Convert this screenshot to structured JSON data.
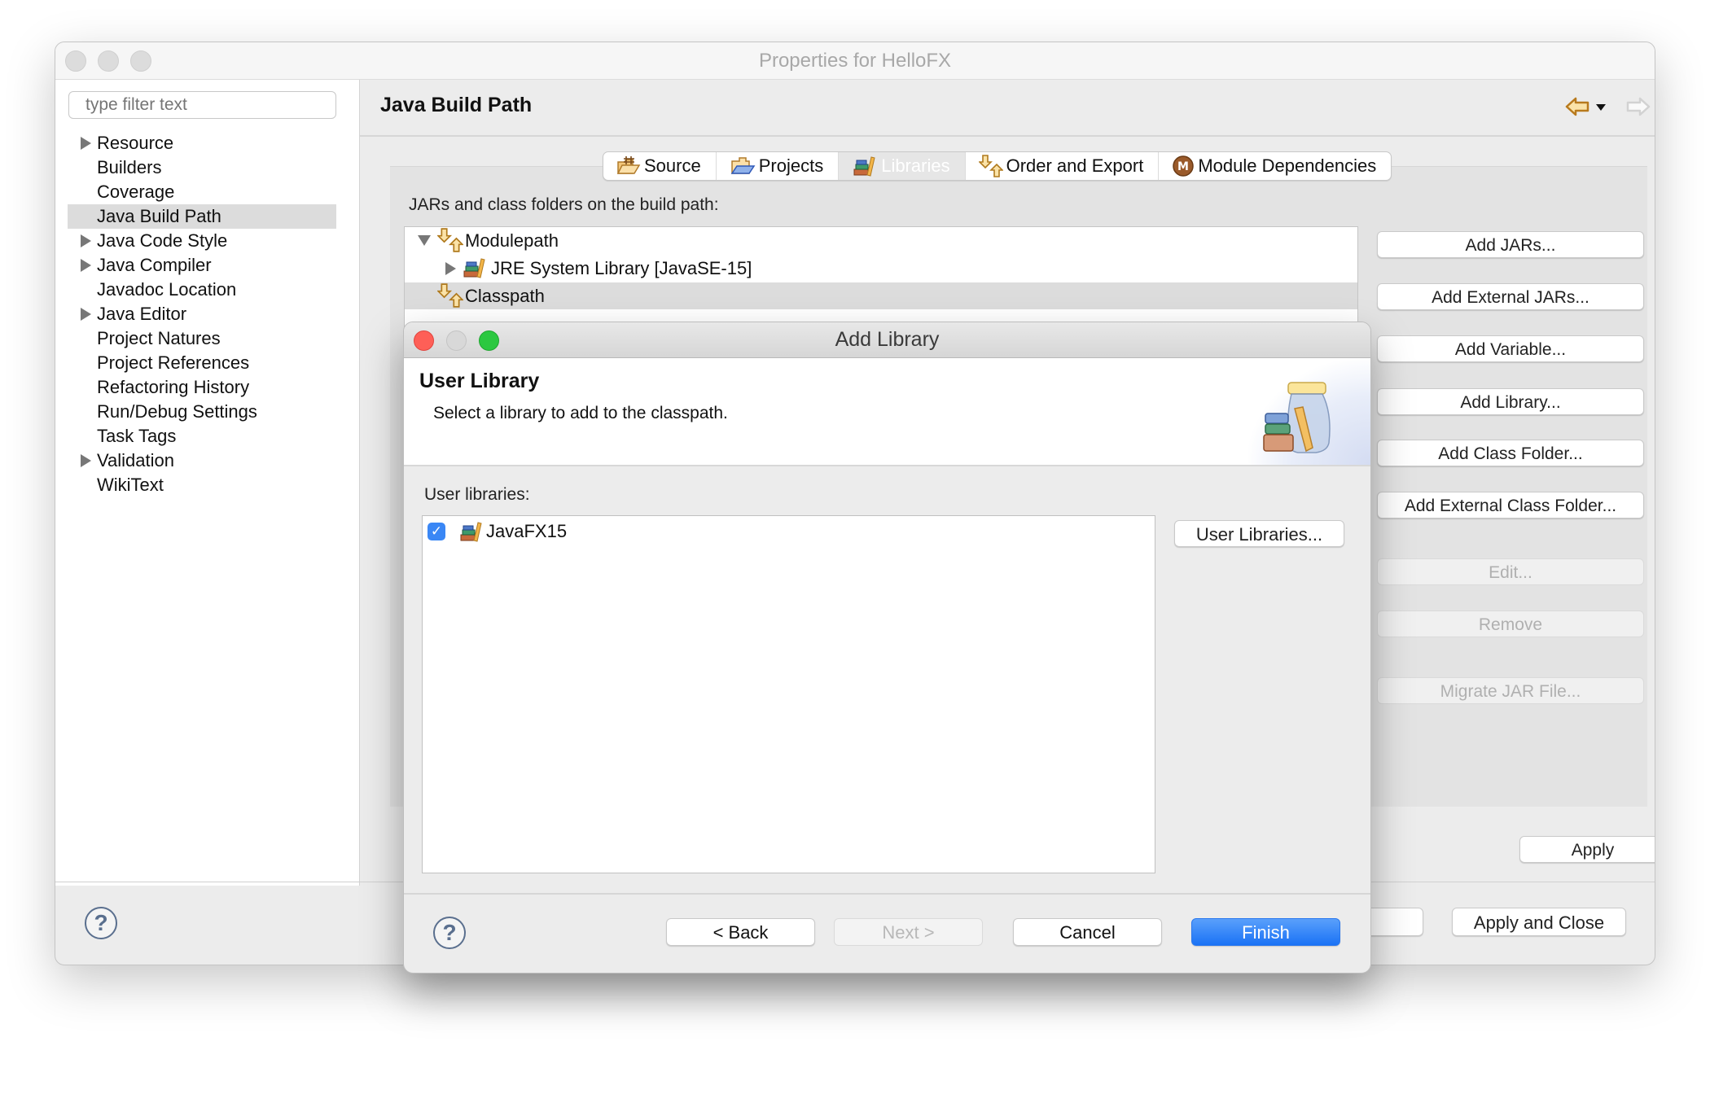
{
  "window": {
    "title": "Properties for HelloFX"
  },
  "sidebar": {
    "filter_placeholder": "type filter text",
    "items": [
      {
        "label": "Resource",
        "expandable": true
      },
      {
        "label": "Builders",
        "expandable": false
      },
      {
        "label": "Coverage",
        "expandable": false
      },
      {
        "label": "Java Build Path",
        "expandable": false,
        "selected": true
      },
      {
        "label": "Java Code Style",
        "expandable": true
      },
      {
        "label": "Java Compiler",
        "expandable": true
      },
      {
        "label": "Javadoc Location",
        "expandable": false
      },
      {
        "label": "Java Editor",
        "expandable": true
      },
      {
        "label": "Project Natures",
        "expandable": false
      },
      {
        "label": "Project References",
        "expandable": false
      },
      {
        "label": "Refactoring History",
        "expandable": false
      },
      {
        "label": "Run/Debug Settings",
        "expandable": false
      },
      {
        "label": "Task Tags",
        "expandable": false
      },
      {
        "label": "Validation",
        "expandable": true
      },
      {
        "label": "WikiText",
        "expandable": false
      }
    ]
  },
  "page": {
    "title": "Java Build Path",
    "nav": {
      "back_icon": "back-arrow-icon",
      "forward_icon": "forward-arrow-icon",
      "menu_icon": "view-menu-icon"
    },
    "tabs": [
      {
        "label": "Source",
        "icon": "source-folder-icon"
      },
      {
        "label": "Projects",
        "icon": "projects-folder-icon"
      },
      {
        "label": "Libraries",
        "icon": "library-icon",
        "active": true
      },
      {
        "label": "Order and Export",
        "icon": "order-export-icon"
      },
      {
        "label": "Module Dependencies",
        "icon": "module-icon"
      }
    ],
    "build_path_label": "JARs and class folders on the build path:",
    "tree": [
      {
        "label": "Modulepath",
        "level": 0,
        "expanded": true
      },
      {
        "label": "JRE System Library [JavaSE-15]",
        "level": 1,
        "expanded": false
      },
      {
        "label": "Classpath",
        "level": 0,
        "selected": true
      }
    ],
    "buttons": [
      {
        "label": "Add JARs...",
        "enabled": true
      },
      {
        "label": "Add External JARs...",
        "enabled": true
      },
      {
        "label": "Add Variable...",
        "enabled": true
      },
      {
        "label": "Add Library...",
        "enabled": true
      },
      {
        "label": "Add Class Folder...",
        "enabled": true
      },
      {
        "label": "Add External Class Folder...",
        "enabled": true
      },
      {
        "label": "Edit...",
        "enabled": false
      },
      {
        "label": "Remove",
        "enabled": false
      },
      {
        "label": "Migrate JAR File...",
        "enabled": false
      }
    ],
    "apply_label": "Apply"
  },
  "footer": {
    "apply_close_label": "Apply and Close",
    "help_icon": "help-icon"
  },
  "dialog": {
    "title": "Add Library",
    "header_title": "User Library",
    "header_subtitle": "Select a library to add to the classpath.",
    "list_label": "User libraries:",
    "libraries": [
      {
        "label": "JavaFX15",
        "checked": true
      }
    ],
    "user_libraries_button": "User Libraries...",
    "buttons": {
      "back": "< Back",
      "next": "Next >",
      "cancel": "Cancel",
      "finish": "Finish"
    },
    "colors": {
      "primary": "#1a72f5",
      "close": "#fe5f57",
      "zoom": "#2bc840"
    }
  }
}
